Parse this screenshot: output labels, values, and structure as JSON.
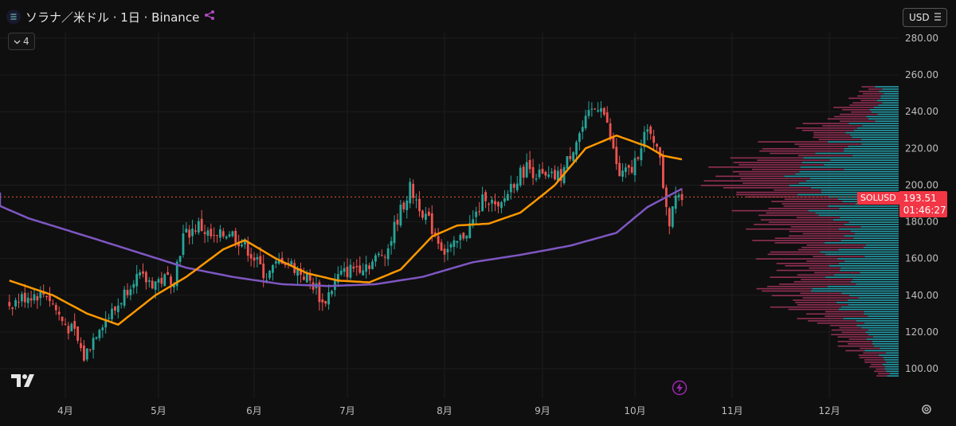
{
  "header": {
    "title": "ソラナ／米ドル · 1日 · Binance",
    "indicator_count": "4"
  },
  "currency_selector": "USD",
  "price_tag": {
    "symbol": "SOLUSD",
    "price": "193.51",
    "countdown": "01:46:27"
  },
  "colors": {
    "up": "#26a69a",
    "down": "#ef5350",
    "sma_short": "#ff9800",
    "sma_long": "#7e57c2",
    "vp_up": "#2ab7c7",
    "vp_down": "#a8355f",
    "current_line": "#f0542f",
    "background": "#0f0f0f"
  },
  "icons": [
    "tradingview-logo-icon",
    "bolt-icon",
    "gear-icon",
    "chevron-down-icon",
    "share-icon"
  ],
  "chart_data": {
    "type": "candlestick",
    "x_unit": "date",
    "x_tick_labels": [
      "4月",
      "5月",
      "6月",
      "7月",
      "8月",
      "9月",
      "10月",
      "11月",
      "12月"
    ],
    "x_tick_dates": [
      "2025-04-01",
      "2025-05-01",
      "2025-06-01",
      "2025-07-01",
      "2025-08-01",
      "2025-09-01",
      "2025-10-01",
      "2025-11-01",
      "2025-12-01"
    ],
    "y_tick_labels": [
      "100.00",
      "120.00",
      "140.00",
      "160.00",
      "180.00",
      "200.00",
      "220.00",
      "240.00",
      "260.00",
      "280.00"
    ],
    "ylim": [
      93,
      286
    ],
    "current_price": 193.51,
    "price_anchors": [
      [
        "2025-03-14",
        135
      ],
      [
        "2025-03-20",
        140
      ],
      [
        "2025-03-26",
        141
      ],
      [
        "2025-03-31",
        126
      ],
      [
        "2025-04-04",
        119
      ],
      [
        "2025-04-07",
        106
      ],
      [
        "2025-04-12",
        124
      ],
      [
        "2025-04-17",
        132
      ],
      [
        "2025-04-23",
        150
      ],
      [
        "2025-04-29",
        147
      ],
      [
        "2025-05-06",
        150
      ],
      [
        "2025-05-09",
        172
      ],
      [
        "2025-05-14",
        178
      ],
      [
        "2025-05-19",
        170
      ],
      [
        "2025-05-24",
        175
      ],
      [
        "2025-05-30",
        165
      ],
      [
        "2025-06-05",
        150
      ],
      [
        "2025-06-10",
        160
      ],
      [
        "2025-06-15",
        154
      ],
      [
        "2025-06-21",
        144
      ],
      [
        "2025-06-23",
        135
      ],
      [
        "2025-06-28",
        150
      ],
      [
        "2025-07-03",
        155
      ],
      [
        "2025-07-09",
        158
      ],
      [
        "2025-07-14",
        166
      ],
      [
        "2025-07-17",
        182
      ],
      [
        "2025-07-21",
        198
      ],
      [
        "2025-07-25",
        186
      ],
      [
        "2025-08-01",
        164
      ],
      [
        "2025-08-04",
        166
      ],
      [
        "2025-08-10",
        180
      ],
      [
        "2025-08-14",
        195
      ],
      [
        "2025-08-18",
        185
      ],
      [
        "2025-08-22",
        200
      ],
      [
        "2025-08-27",
        210
      ],
      [
        "2025-09-02",
        203
      ],
      [
        "2025-09-07",
        205
      ],
      [
        "2025-09-12",
        225
      ],
      [
        "2025-09-17",
        240
      ],
      [
        "2025-09-20",
        245
      ],
      [
        "2025-09-26",
        205
      ],
      [
        "2025-09-30",
        208
      ],
      [
        "2025-10-04",
        228
      ],
      [
        "2025-10-08",
        224
      ],
      [
        "2025-10-10",
        200
      ],
      [
        "2025-10-12",
        180
      ],
      [
        "2025-10-14",
        198
      ],
      [
        "2025-10-16",
        193.5
      ]
    ],
    "sma_short_anchors": [
      [
        "2025-03-14",
        148
      ],
      [
        "2025-03-28",
        140
      ],
      [
        "2025-04-08",
        130
      ],
      [
        "2025-04-18",
        124
      ],
      [
        "2025-04-30",
        140
      ],
      [
        "2025-05-10",
        150
      ],
      [
        "2025-05-22",
        165
      ],
      [
        "2025-05-29",
        170
      ],
      [
        "2025-06-08",
        160
      ],
      [
        "2025-06-18",
        152
      ],
      [
        "2025-06-28",
        148
      ],
      [
        "2025-07-08",
        147
      ],
      [
        "2025-07-18",
        154
      ],
      [
        "2025-07-28",
        172
      ],
      [
        "2025-08-05",
        178
      ],
      [
        "2025-08-15",
        179
      ],
      [
        "2025-08-25",
        185
      ],
      [
        "2025-09-05",
        200
      ],
      [
        "2025-09-15",
        220
      ],
      [
        "2025-09-25",
        227
      ],
      [
        "2025-10-05",
        221
      ],
      [
        "2025-10-10",
        216
      ],
      [
        "2025-10-16",
        214
      ]
    ],
    "sma_long_anchors": [
      [
        "2025-03-01",
        196
      ],
      [
        "2025-03-20",
        182
      ],
      [
        "2025-04-10",
        171
      ],
      [
        "2025-04-25",
        163
      ],
      [
        "2025-05-10",
        155
      ],
      [
        "2025-05-25",
        150
      ],
      [
        "2025-06-10",
        146
      ],
      [
        "2025-06-25",
        145
      ],
      [
        "2025-07-10",
        146
      ],
      [
        "2025-07-25",
        150
      ],
      [
        "2025-08-10",
        158
      ],
      [
        "2025-08-25",
        162
      ],
      [
        "2025-09-10",
        167
      ],
      [
        "2025-09-25",
        174
      ],
      [
        "2025-10-05",
        188
      ],
      [
        "2025-10-16",
        198
      ]
    ],
    "volume_profile_range": [
      96,
      254
    ],
    "volume_profile_peak": 200
  }
}
